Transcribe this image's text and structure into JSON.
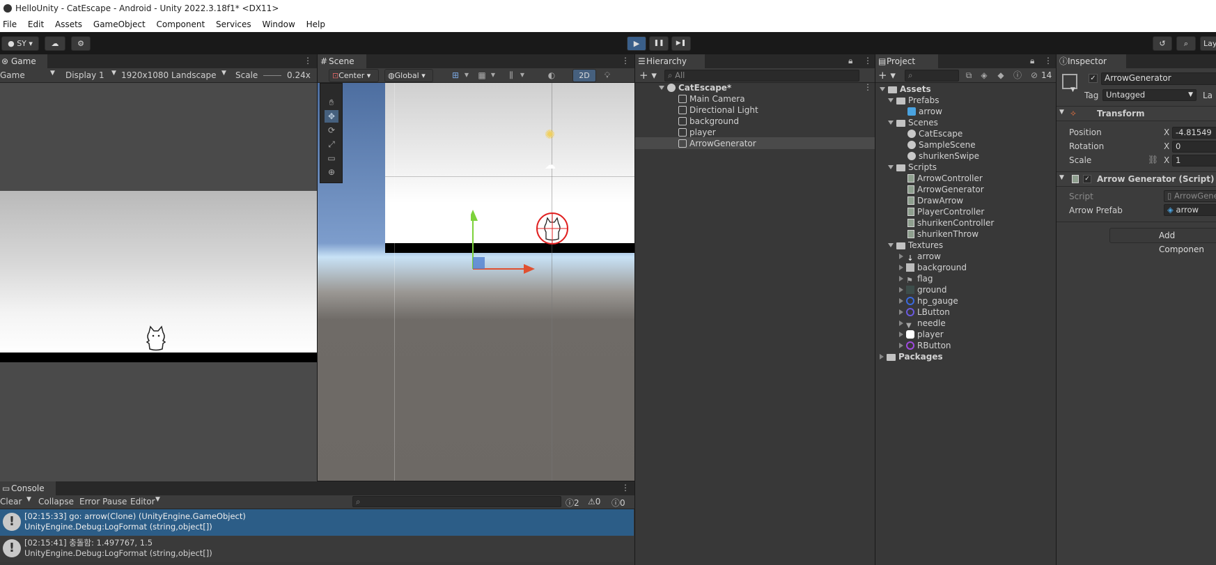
{
  "window_title": "HelloUnity - CatEscape - Android - Unity 2022.3.18f1* <DX11>",
  "menu": [
    "File",
    "Edit",
    "Assets",
    "GameObject",
    "Component",
    "Services",
    "Window",
    "Help"
  ],
  "toolbar": {
    "account": "SY",
    "play": "▶",
    "pause": "❚❚",
    "step": "▶❚",
    "layers": "Lay"
  },
  "game": {
    "tab": "Game",
    "mode": "Game",
    "display": "Display 1",
    "resolution": "1920x1080 Landscape",
    "scale_label": "Scale",
    "scale_value": "0.24x"
  },
  "scene": {
    "tab": "Scene",
    "pivot": "Center",
    "space": "Global",
    "mode_2d": "2D"
  },
  "hierarchy": {
    "tab": "Hierarchy",
    "search_placeholder": "All",
    "scene_name": "CatEscape*",
    "items": [
      "Main Camera",
      "Directional Light",
      "background",
      "player",
      "ArrowGenerator"
    ]
  },
  "project": {
    "tab": "Project",
    "hidden_count": "14",
    "assets": "Assets",
    "prefabs": "Prefabs",
    "prefab_items": [
      "arrow"
    ],
    "scenes": "Scenes",
    "scene_items": [
      "CatEscape",
      "SampleScene",
      "shurikenSwipe"
    ],
    "scripts": "Scripts",
    "script_items": [
      "ArrowController",
      "ArrowGenerator",
      "DrawArrow",
      "PlayerController",
      "shurikenController",
      "shurikenThrow"
    ],
    "textures": "Textures",
    "texture_items": [
      "arrow",
      "background",
      "flag",
      "ground",
      "hp_gauge",
      "LButton",
      "needle",
      "player",
      "RButton"
    ],
    "packages": "Packages"
  },
  "inspector": {
    "tab": "Inspector",
    "object_name": "ArrowGenerator",
    "tag_label": "Tag",
    "tag_value": "Untagged",
    "layer_label": "La",
    "transform_title": "Transform",
    "position_label": "Position",
    "position_x": "-4.81549",
    "rotation_label": "Rotation",
    "rotation_x": "0",
    "scale_label": "Scale",
    "scale_x": "1",
    "axis_x": "X",
    "script_component": "Arrow Generator (Script)",
    "script_label": "Script",
    "script_value": "ArrowGene",
    "arrow_prefab_label": "Arrow Prefab",
    "arrow_prefab_value": "arrow",
    "add_component": "Add Componen"
  },
  "console": {
    "tab": "Console",
    "clear": "Clear",
    "collapse": "Collapse",
    "error_pause": "Error Pause",
    "editor": "Editor",
    "count_info": "2",
    "count_warn": "0",
    "count_error": "0",
    "lines": [
      {
        "msg": "[02:15:33] go: arrow(Clone) (UnityEngine.GameObject)",
        "trace": "UnityEngine.Debug:LogFormat (string,object[])"
      },
      {
        "msg": "[02:15:41] 충돌함: 1.497767, 1.5",
        "trace": "UnityEngine.Debug:LogFormat (string,object[])"
      }
    ]
  }
}
